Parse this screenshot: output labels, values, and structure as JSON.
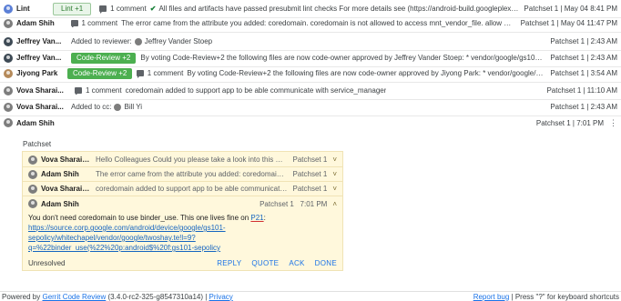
{
  "messages": [
    {
      "author": "Lint",
      "badge": "Lint +1",
      "check": "✔",
      "comment_count": "1 comment",
      "summary": "All files and artifacts have passed presubmit lint checks For more details see (https://android-build.googleplex.c...",
      "meta": "Patchset 1 | May 04 8:41 PM"
    },
    {
      "author": "Adam Shih",
      "comment_count": "1 comment",
      "summary": "The error came from the attribute you added: coredomain. coredomain is not allowed to access mnt_vendor_file. allow oslo_app ...",
      "meta": "Patchset 1 | May 04 11:47 PM"
    },
    {
      "author": "Jeffrey Van...",
      "summary_prefix": "Added to reviewer:",
      "summary_name": "Jeffrey Vander Stoep",
      "meta": "Patchset 1 | 2:43 AM"
    },
    {
      "author": "Jeffrey Van...",
      "badge": "Code-Review +2",
      "summary": "By voting Code-Review+2 the following files are now code-owner approved by Jeffrey Vander Stoep: * vendor/google/gs101-...",
      "meta": "Patchset 1 | 2:43 AM"
    },
    {
      "author": "Jiyong Park",
      "badge": "Code-Review +2",
      "comment_count": "1 comment",
      "summary": "By voting Code-Review+2 the following files are now code-owner approved by Jiyong Park: * vendor/google/oslo_app.te",
      "meta": "Patchset 1 | 3:54 AM"
    },
    {
      "author": "Vova Sharai...",
      "comment_count": "1 comment",
      "summary": "coredomain added to support app to be able communicate with service_manager",
      "meta": "Patchset 1 | 11:10 AM"
    },
    {
      "author": "Vova Sharai...",
      "summary_prefix": "Added to cc:",
      "summary_name": "Bill Yi",
      "meta": "Patchset 1 | 2:43 AM"
    },
    {
      "author": "Adam Shih",
      "meta": "Patchset 1 | 7:01 PM"
    }
  ],
  "expanded": {
    "patchset_label": "Patchset",
    "thread": [
      {
        "author": "Vova Sharaie...",
        "summary": "Hello Colleagues Could you please take a look into this CL? I d...",
        "meta": "Patchset 1",
        "chevron": "˅"
      },
      {
        "author": "Adam Shih",
        "summary": "The error came from the attribute you added: coredomain. corre...",
        "meta": "Patchset 1",
        "chevron": "˅"
      },
      {
        "author": "Vova Sharaie...",
        "summary": "coredomain added to support app to be able communicate wit...",
        "meta": "Patchset 1",
        "chevron": "˅"
      }
    ],
    "open_comment": {
      "author": "Adam Shih",
      "meta": "Patchset 1   7:01 PM",
      "chevron": "˄",
      "body_text": "You don't need coredomain to use binder_use. This one lives fine on ",
      "body_link_p21": "P21",
      "body_colon": ":",
      "url_line1": "https://source.corp.google.com/android/device/google/gs101-",
      "url_line2": "sepolicy/whitechapel/vendor/google/twoshay.te!l=9?",
      "url_line3": "q=%22binder_use(%22%20p:android$%20f:gs101-sepolicy"
    },
    "status": "Unresolved",
    "actions": [
      "REPLY",
      "QUOTE",
      "ACK",
      "DONE"
    ]
  },
  "footer": {
    "powered_prefix": "Powered by ",
    "gerrit_link": "Gerrit Code Review",
    "version": " (3.4.0-rc2-325-g8547310a14) | ",
    "privacy": "Privacy",
    "report_bug": "Report bug",
    "shortcuts": " | Press \"?\" for keyboard shortcuts"
  },
  "colors": {
    "accent_link": "#1a73e8",
    "vote_green": "#4caf50",
    "thread_bg": "#fff8dc",
    "underline_red": "#d32f2f"
  }
}
